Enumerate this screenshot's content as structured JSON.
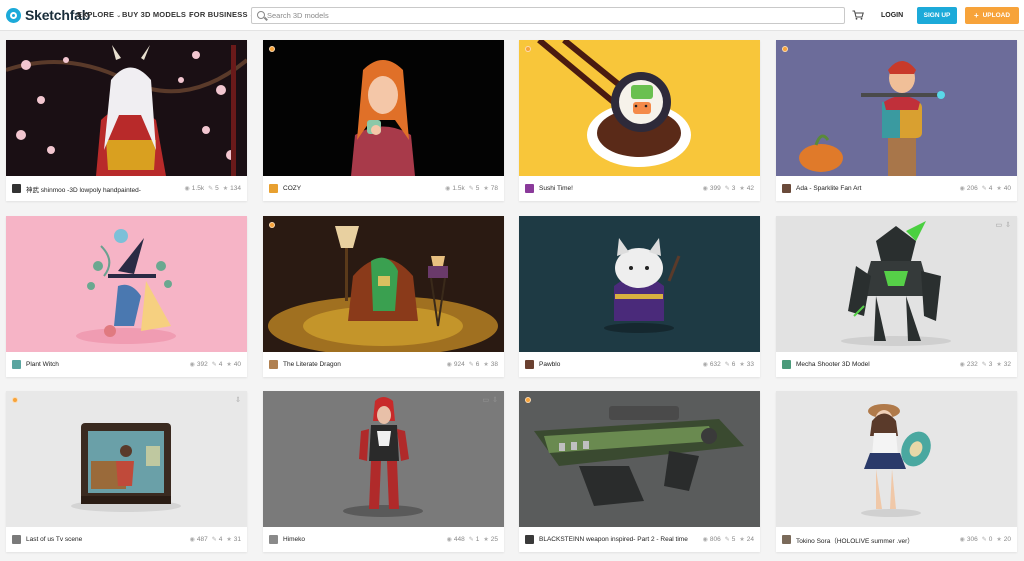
{
  "header": {
    "logo_text": "Sketchfab",
    "nav": [
      {
        "label": "EXPLORE"
      },
      {
        "label": "BUY 3D MODELS"
      },
      {
        "label": "FOR BUSINESS"
      }
    ],
    "search_placeholder": "Search 3D models",
    "login_label": "LOGIN",
    "signup_label": "SIGN UP",
    "upload_label": "UPLOAD"
  },
  "colors": {
    "accent": "#1caad9",
    "upload": "#f7a33a"
  },
  "models": [
    {
      "title": "神武 shinmoo -3D lowpoly handpainted-",
      "views": "1.5k",
      "comments": "5",
      "likes": "134",
      "avatar_color": "#333333",
      "staff_pick": false
    },
    {
      "title": "COZY",
      "views": "1.5k",
      "comments": "5",
      "likes": "78",
      "avatar_color": "#e8a030",
      "staff_pick": true
    },
    {
      "title": "Sushi Time!",
      "views": "399",
      "comments": "3",
      "likes": "42",
      "avatar_color": "#8a3a9a",
      "staff_pick": true
    },
    {
      "title": "Ada - Sparklite Fan Art",
      "views": "206",
      "comments": "4",
      "likes": "40",
      "avatar_color": "#6a4a3a",
      "staff_pick": true
    },
    {
      "title": "Plant Witch",
      "views": "392",
      "comments": "4",
      "likes": "40",
      "avatar_color": "#5aa5a0",
      "staff_pick": false
    },
    {
      "title": "The Literate Dragon",
      "views": "924",
      "comments": "6",
      "likes": "38",
      "avatar_color": "#b08050",
      "staff_pick": true
    },
    {
      "title": "Pawblo",
      "views": "632",
      "comments": "6",
      "likes": "33",
      "avatar_color": "#6a4030",
      "staff_pick": false
    },
    {
      "title": "Mecha Shooter 3D Model",
      "views": "232",
      "comments": "3",
      "likes": "32",
      "avatar_color": "#4a9a7a",
      "staff_pick": false
    },
    {
      "title": "Last of us Tv scene",
      "views": "487",
      "comments": "4",
      "likes": "31",
      "avatar_color": "#7a7a7a",
      "staff_pick": true
    },
    {
      "title": "Himeko",
      "views": "448",
      "comments": "1",
      "likes": "25",
      "avatar_color": "#8a8a8a",
      "staff_pick": false
    },
    {
      "title": "BLACKSTEINN weapon inspired- Part 2 - Real time",
      "views": "806",
      "comments": "5",
      "likes": "24",
      "avatar_color": "#3a3a3a",
      "staff_pick": true
    },
    {
      "title": "Tokino Sora（HOLOLIVE summer .ver）",
      "views": "306",
      "comments": "0",
      "likes": "20",
      "avatar_color": "#7a6a5a",
      "staff_pick": false
    }
  ]
}
